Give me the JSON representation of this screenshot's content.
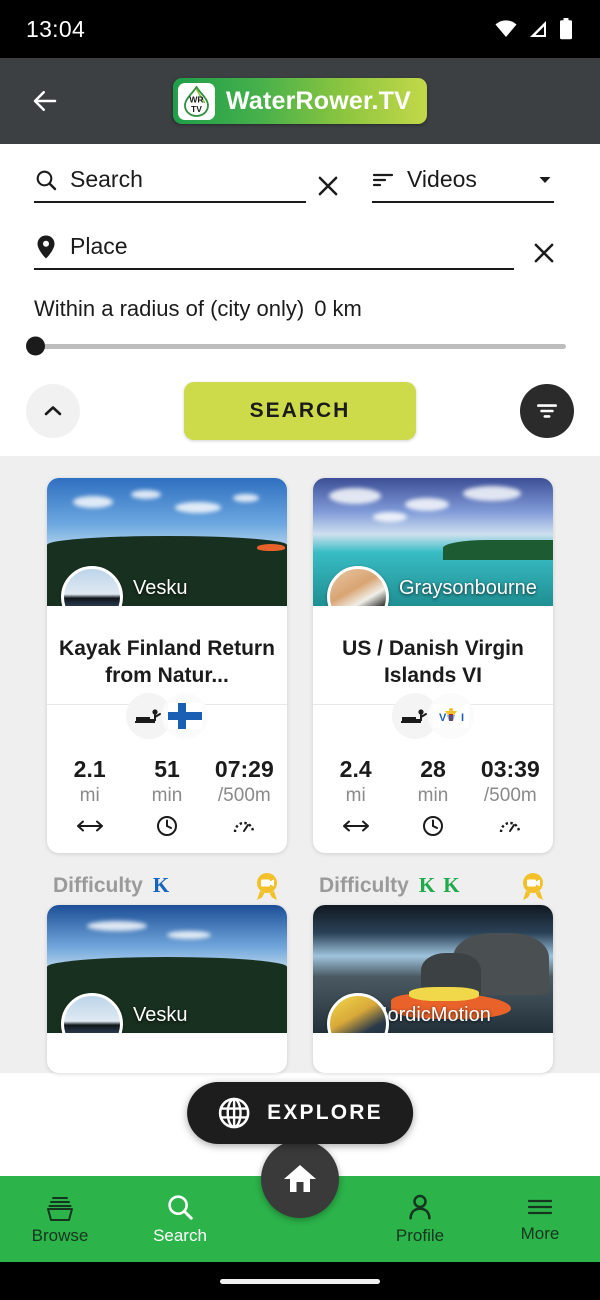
{
  "status_bar": {
    "time": "13:04",
    "wifi_icon": "wifi-icon",
    "signal_icon": "cell-signal-icon",
    "battery_icon": "battery-icon"
  },
  "app_bar": {
    "back_icon": "back-arrow-icon",
    "brand": "WaterRower.TV",
    "logo_mark_top": "WR",
    "logo_mark_bottom": "TV"
  },
  "search_panel": {
    "search_icon": "search-icon",
    "search_placeholder": "Search",
    "search_value": "",
    "search_clear_icon": "close-icon",
    "kind_icon": "sort-icon",
    "kind_value": "Videos",
    "kind_caret_icon": "chevron-down-icon",
    "place_icon": "location-pin-icon",
    "place_placeholder": "Place",
    "place_value": "",
    "place_clear_icon": "close-icon",
    "radius_label": "Within a radius of (city only)",
    "radius_value": "0 km",
    "radius_slider_percent": 0,
    "collapse_icon": "chevron-up-icon",
    "search_button": "SEARCH",
    "filter_icon": "filter-icon"
  },
  "colors": {
    "accent_green": "#2cb34a",
    "search_button": "#cdda49",
    "app_bar": "#3c4043",
    "results_bg": "#efefef",
    "difficulty_blue": "#1565c0",
    "difficulty_green": "#1faa4b",
    "award_gold": "#f2c02a"
  },
  "results": {
    "cards": [
      {
        "channel": "Vesku",
        "title": "Kayak Finland Return from Natur...",
        "sport_icon": "rowing-machine-icon",
        "flag_icon": "flag-finland-icon",
        "stats": [
          {
            "value": "2.1",
            "unit": "mi",
            "icon": "distance-icon"
          },
          {
            "value": "51",
            "unit": "min",
            "icon": "clock-icon"
          },
          {
            "value": "07:29",
            "unit": "/500m",
            "icon": "speed-icon"
          }
        ],
        "difficulty_label": "Difficulty",
        "difficulty_count": 1,
        "difficulty_color": "#1565c0",
        "award_icon": "award-medal-icon"
      },
      {
        "channel": "Graysonbourne",
        "title": "US  / Danish Virgin Islands VI",
        "sport_icon": "rowing-machine-icon",
        "flag_icon": "flag-us-virgin-islands-icon",
        "stats": [
          {
            "value": "2.4",
            "unit": "mi",
            "icon": "distance-icon"
          },
          {
            "value": "28",
            "unit": "min",
            "icon": "clock-icon"
          },
          {
            "value": "03:39",
            "unit": "/500m",
            "icon": "speed-icon"
          }
        ],
        "difficulty_label": "Difficulty",
        "difficulty_count": 2,
        "difficulty_color": "#1faa4b",
        "award_icon": "award-medal-icon"
      },
      {
        "channel": "Vesku"
      },
      {
        "channel": "NordicMotion"
      }
    ]
  },
  "explore": {
    "icon": "globe-icon",
    "label": "EXPLORE"
  },
  "bottom_nav": {
    "items": [
      {
        "label": "Browse",
        "icon": "browse-icon",
        "active": false
      },
      {
        "label": "Search",
        "icon": "search-icon",
        "active": true
      },
      {
        "label": "Profile",
        "icon": "person-icon",
        "active": false
      },
      {
        "label": "More",
        "icon": "menu-icon",
        "active": false
      }
    ],
    "home_icon": "home-icon"
  }
}
